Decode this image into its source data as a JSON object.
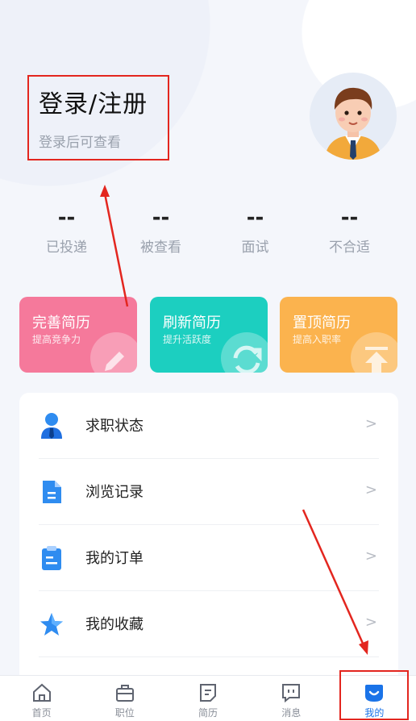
{
  "header": {
    "login_title": "登录/注册",
    "login_subtitle": "登录后可查看"
  },
  "stats": [
    {
      "value": "--",
      "label": "已投递"
    },
    {
      "value": "--",
      "label": "被查看"
    },
    {
      "value": "--",
      "label": "面试"
    },
    {
      "value": "--",
      "label": "不合适"
    }
  ],
  "cards": [
    {
      "title": "完善简历",
      "subtitle": "提高竞争力",
      "color": "#f5799b",
      "icon": "pencil-icon"
    },
    {
      "title": "刷新简历",
      "subtitle": "提升活跃度",
      "color": "#1ccfc0",
      "icon": "refresh-icon"
    },
    {
      "title": "置顶简历",
      "subtitle": "提高入职率",
      "color": "#fbb34e",
      "icon": "arrow-up-icon"
    }
  ],
  "menu": [
    {
      "label": "求职状态",
      "icon": "person-icon"
    },
    {
      "label": "浏览记录",
      "icon": "document-icon"
    },
    {
      "label": "我的订单",
      "icon": "clipboard-icon"
    },
    {
      "label": "我的收藏",
      "icon": "star-icon"
    }
  ],
  "tabs": [
    {
      "label": "首页",
      "icon": "home-icon"
    },
    {
      "label": "职位",
      "icon": "briefcase-icon"
    },
    {
      "label": "简历",
      "icon": "resume-icon"
    },
    {
      "label": "消息",
      "icon": "message-icon"
    },
    {
      "label": "我的",
      "icon": "profile-icon",
      "active": true
    }
  ],
  "colors": {
    "accent": "#1a73e8",
    "annotation": "#e3261f"
  }
}
